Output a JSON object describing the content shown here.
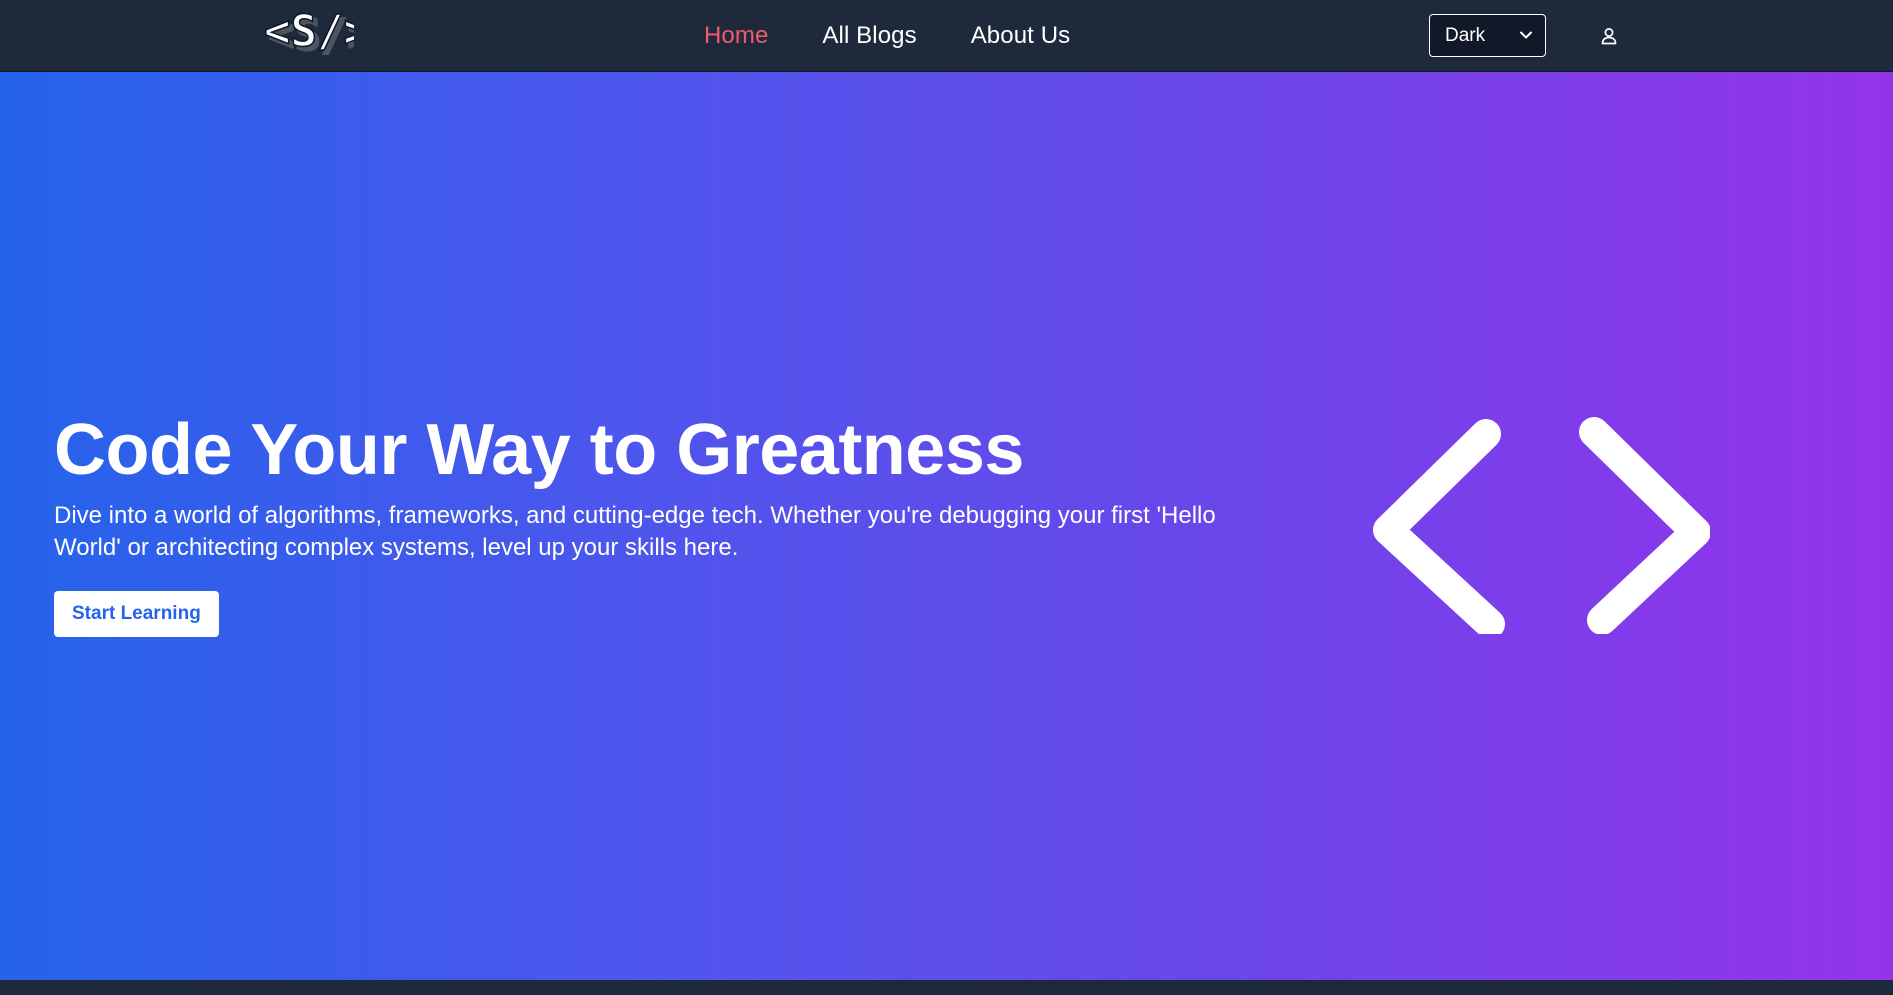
{
  "brand": {
    "logo_text": "<S/>",
    "logo_icon": "code-slash-logo"
  },
  "nav": {
    "items": [
      {
        "label": "Home",
        "active": true
      },
      {
        "label": "All Blogs",
        "active": false
      },
      {
        "label": "About Us",
        "active": false
      }
    ]
  },
  "theme": {
    "selected": "Dark",
    "icon": "chevron-down-icon"
  },
  "user": {
    "icon": "user-icon"
  },
  "hero": {
    "title": "Code Your Way to Greatness",
    "subtitle": "Dive into a world of algorithms, frameworks, and cutting-edge tech. Whether you're debugging your first 'Hello World' or architecting complex systems, level up your skills here.",
    "cta_label": "Start Learning",
    "illustration_icon": "code-brackets-icon"
  },
  "colors": {
    "nav_bg": "#1e293b",
    "active_link": "#f05a6e",
    "gradient_start": "#2563eb",
    "gradient_end": "#9333ea",
    "cta_text": "#2563eb"
  }
}
